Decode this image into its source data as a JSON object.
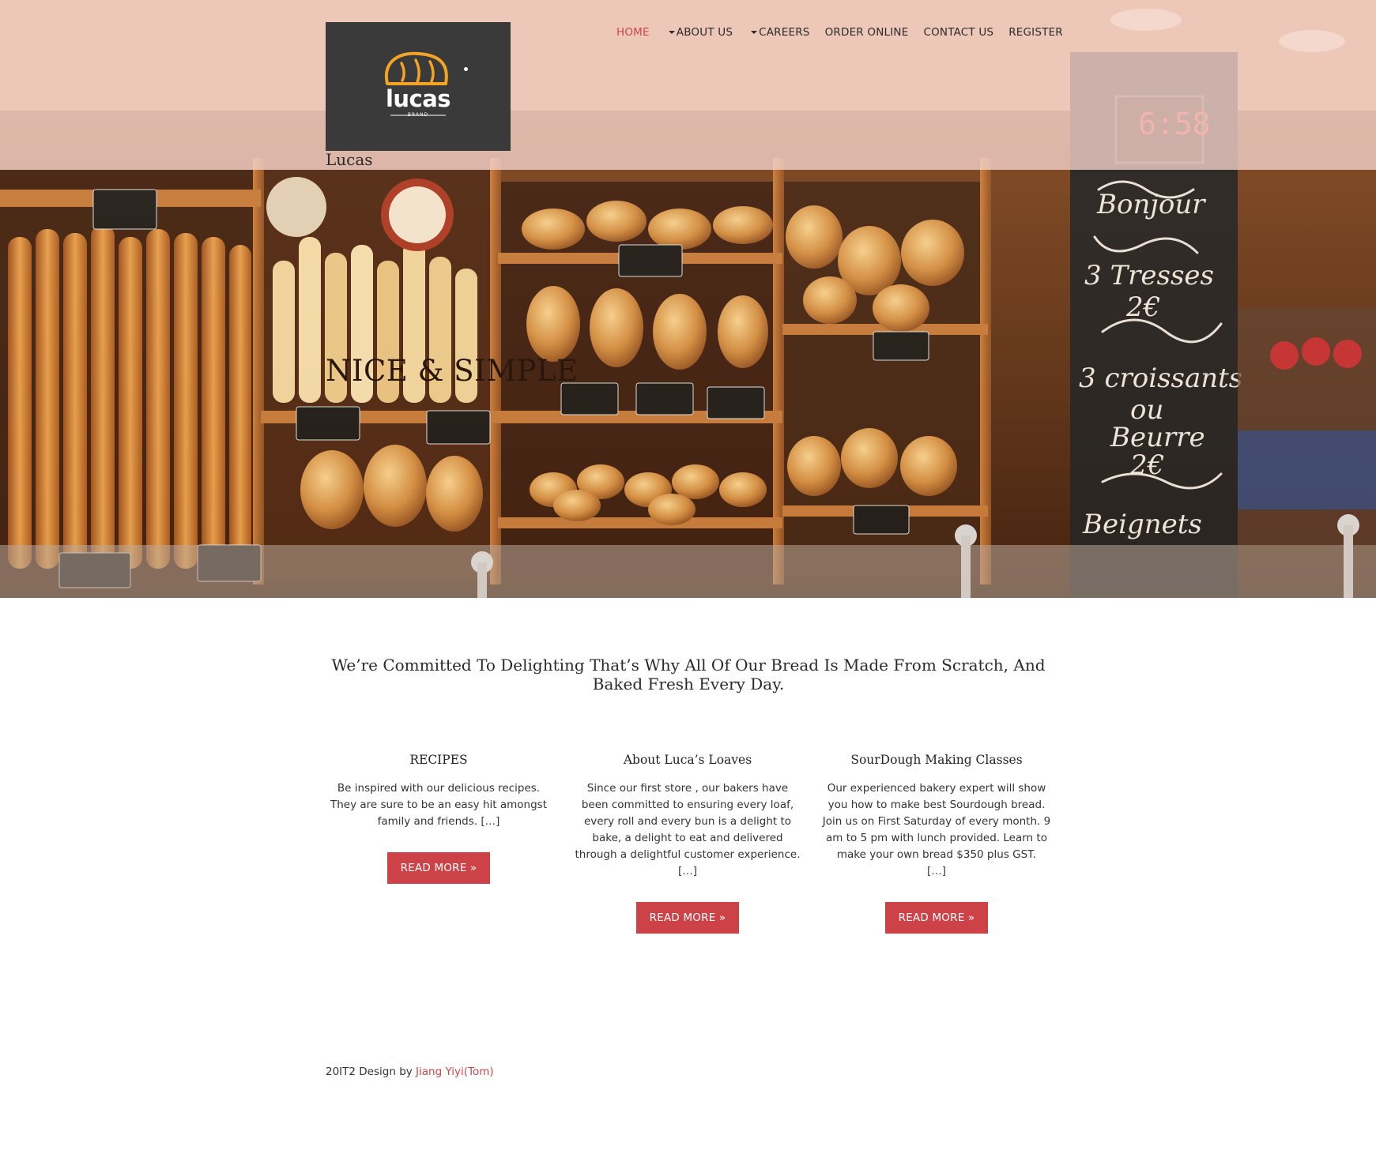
{
  "brand": {
    "logo_word": "lucas",
    "logo_sub": "BRAND",
    "site_name": "Lucas"
  },
  "nav": {
    "items": [
      {
        "label": "HOME",
        "active": true,
        "dropdown": false
      },
      {
        "label": "ABOUT US",
        "active": false,
        "dropdown": true
      },
      {
        "label": "CAREERS",
        "active": false,
        "dropdown": true
      },
      {
        "label": "ORDER ONLINE",
        "active": false,
        "dropdown": false
      },
      {
        "label": "CONTACT US",
        "active": false,
        "dropdown": false
      },
      {
        "label": "REGISTER",
        "active": false,
        "dropdown": false
      }
    ]
  },
  "hero": {
    "title": "NICE & SIMPLE"
  },
  "tagline": "We’re Committed To Delighting That’s Why All Of Our Bread Is Made From Scratch, And Baked Fresh Every Day.",
  "columns": [
    {
      "title": "RECIPES",
      "text": "Be inspired with our delicious recipes. They are sure to be an easy hit amongst family and friends.",
      "ellipsis": "[…]",
      "button": "READ MORE »"
    },
    {
      "title": "About Luca’s Loaves",
      "text": "Since our first store , our bakers have been committed to ensuring every loaf, every roll and every bun is a delight to bake, a delight to eat and delivered through a delightful customer experience.",
      "ellipsis": "[…]",
      "button": "READ MORE »"
    },
    {
      "title": "SourDough Making Classes",
      "text": "Our experienced bakery expert will show you how to make best Sourdough bread. Join us on First Saturday of every month. 9 am to 5 pm with lunch provided. Learn to make your own bread $350 plus GST.",
      "ellipsis": "[…]",
      "button": "READ MORE »"
    }
  ],
  "footer": {
    "prefix": "20IT2 Design by",
    "author": "Jiang Yiyi(Tom)"
  },
  "colors": {
    "accent": "#cd4246",
    "nav_active": "#c9474c",
    "logo_bg": "#3b3a3b",
    "logo_gold": "#f2a424"
  }
}
